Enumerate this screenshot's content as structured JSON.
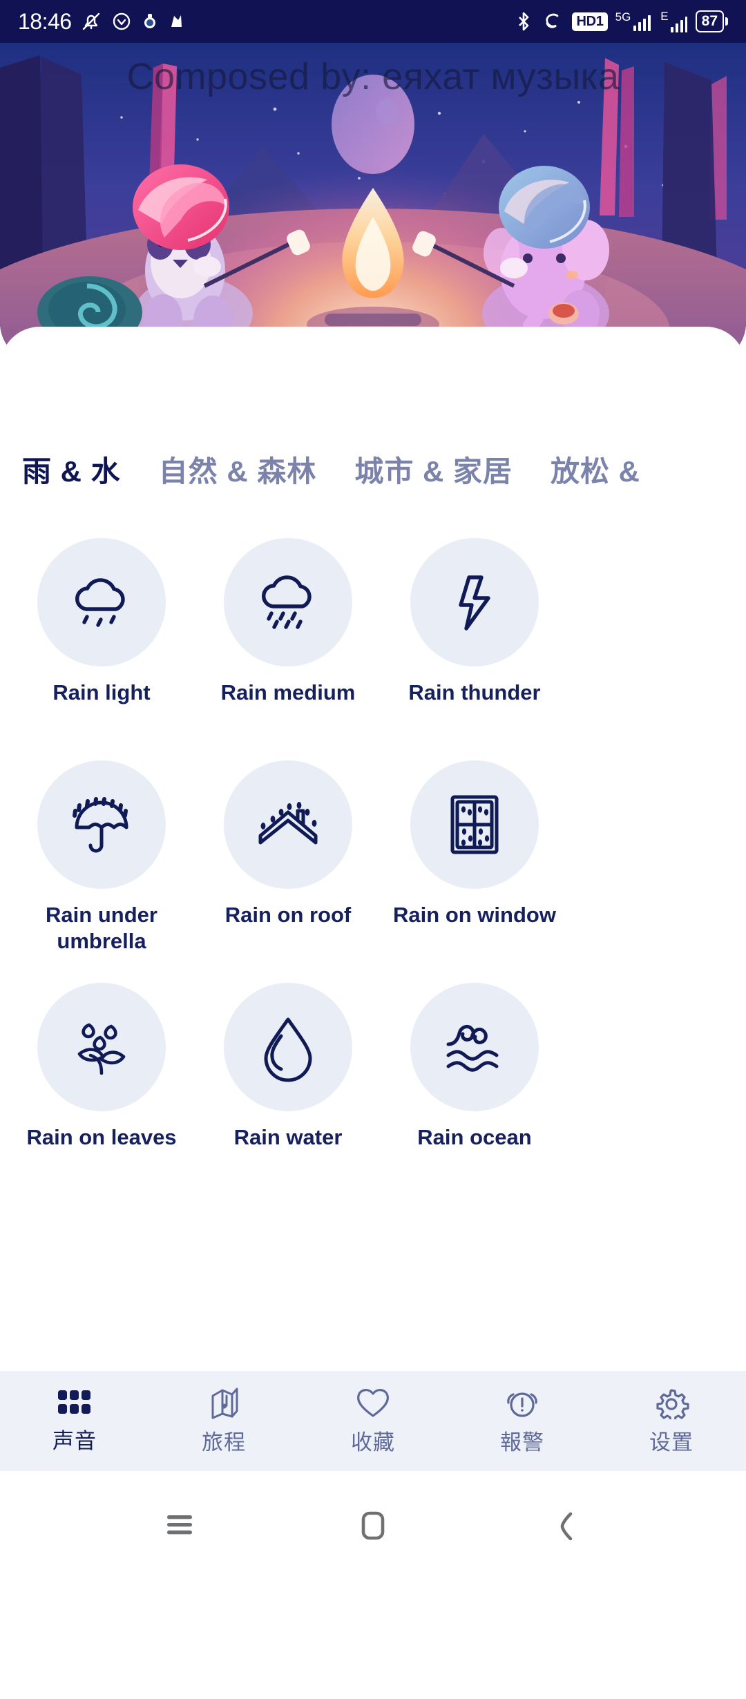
{
  "status_bar": {
    "time": "18:46",
    "left_icons": [
      "mute-bell-icon",
      "alarm-clock-icon",
      "app-badge-icon",
      "app-badge-2-icon"
    ],
    "right_icons": [
      "bluetooth-icon",
      "vpn-icon",
      "hd1-icon",
      "5g-signal-icon",
      "e-signal-icon",
      "battery-icon"
    ],
    "network_5g": "5G",
    "network_e": "E",
    "hd_label": "HD1",
    "battery_level": "87",
    "background_color": "#111254"
  },
  "hero": {
    "watermark": "Composed by: еяхат музыка",
    "alt": "two animal characters roasting marshmallows at a campfire at night"
  },
  "tabs": [
    {
      "label": "雨 & 水",
      "active": true
    },
    {
      "label": "自然 & 森林",
      "active": false
    },
    {
      "label": "城市 & 家居",
      "active": false
    },
    {
      "label": "放松 &",
      "active": false
    }
  ],
  "sounds": [
    {
      "label": "Rain light",
      "icon": "cloud-light-rain-icon"
    },
    {
      "label": "Rain medium",
      "icon": "cloud-medium-rain-icon"
    },
    {
      "label": "Rain thunder",
      "icon": "lightning-bolt-icon"
    },
    {
      "label": "Rain under umbrella",
      "icon": "umbrella-rain-icon"
    },
    {
      "label": "Rain on roof",
      "icon": "roof-rain-icon"
    },
    {
      "label": "Rain on window",
      "icon": "window-rain-icon"
    },
    {
      "label": "Rain on leaves",
      "icon": "leaves-rain-icon"
    },
    {
      "label": "Rain water",
      "icon": "water-droplet-icon"
    },
    {
      "label": "Rain ocean",
      "icon": "ocean-waves-icon"
    }
  ],
  "player": {
    "play_label": "play-icon",
    "timer_label": "stopwatch-icon",
    "expand_label": "chevron-up-icon",
    "accent_color": "#e5187f"
  },
  "bottom_nav": [
    {
      "label": "声音",
      "icon": "grid-icon",
      "active": true
    },
    {
      "label": "旅程",
      "icon": "map-icon",
      "active": false
    },
    {
      "label": "收藏",
      "icon": "heart-icon",
      "active": false
    },
    {
      "label": "報警",
      "icon": "alarm-icon",
      "active": false
    },
    {
      "label": "设置",
      "icon": "gear-icon",
      "active": false
    }
  ],
  "system_nav": [
    {
      "icon": "menu-icon"
    },
    {
      "icon": "home-icon"
    },
    {
      "icon": "back-icon"
    }
  ],
  "colors": {
    "ink": "#15205c",
    "muted": "#7b83ab",
    "circle_bg": "#e9edf6",
    "nav_bg": "#eef1f8"
  }
}
